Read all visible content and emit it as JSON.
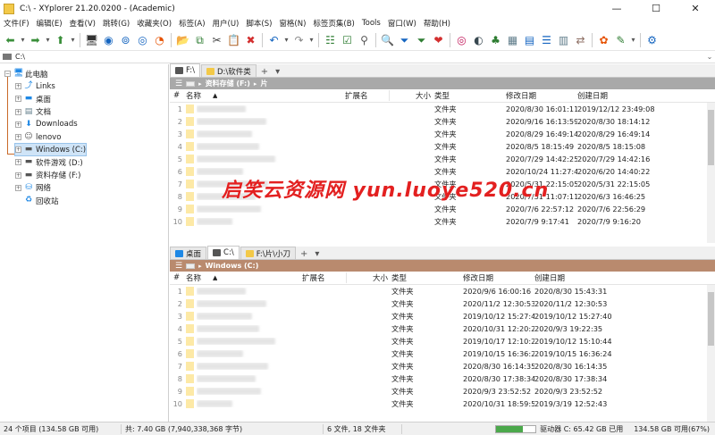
{
  "window": {
    "title": "C:\\ - XYplorer 21.20.0200 - (Academic)",
    "min": "—",
    "max": "☐",
    "close": "✕"
  },
  "menu": [
    "文件(F)",
    "编辑(E)",
    "查看(V)",
    "跳转(G)",
    "收藏夹(O)",
    "标签(A)",
    "用户(U)",
    "脚本(S)",
    "窗格(N)",
    "标签页集(B)",
    "Tools",
    "窗口(W)",
    "帮助(H)"
  ],
  "toolbar": [
    {
      "name": "back-icon",
      "glyph": "⬅",
      "color": "#3a8f3a"
    },
    {
      "name": "back-dropdown-icon",
      "glyph": "▾",
      "color": "#555"
    },
    {
      "name": "forward-icon",
      "glyph": "➡",
      "color": "#3a8f3a"
    },
    {
      "name": "forward-dropdown-icon",
      "glyph": "▾",
      "color": "#555"
    },
    {
      "name": "up-icon",
      "glyph": "⬆",
      "color": "#3a8f3a"
    },
    {
      "name": "up-dropdown-icon",
      "glyph": "▾",
      "color": "#555"
    },
    {
      "name": "sep"
    },
    {
      "name": "computer-icon",
      "glyph": "🖥",
      "color": "#333"
    },
    {
      "name": "target-icon",
      "glyph": "◉",
      "color": "#1565c0"
    },
    {
      "name": "find-icon",
      "glyph": "⊚",
      "color": "#1565c0"
    },
    {
      "name": "history-icon",
      "glyph": "◎",
      "color": "#1565c0"
    },
    {
      "name": "recent-icon",
      "glyph": "◔",
      "color": "#e65100"
    },
    {
      "name": "sep"
    },
    {
      "name": "new-folder-icon",
      "glyph": "📂",
      "color": "#d9a520"
    },
    {
      "name": "copy-icon",
      "glyph": "⧉",
      "color": "#2e7d32"
    },
    {
      "name": "cut-icon",
      "glyph": "✂",
      "color": "#444"
    },
    {
      "name": "paste-icon",
      "glyph": "📋",
      "color": "#555"
    },
    {
      "name": "delete-icon",
      "glyph": "✖",
      "color": "#d32f2f"
    },
    {
      "name": "sep"
    },
    {
      "name": "undo-icon",
      "glyph": "↶",
      "color": "#1565c0"
    },
    {
      "name": "undo-dropdown-icon",
      "glyph": "▾",
      "color": "#555"
    },
    {
      "name": "redo-icon",
      "glyph": "↷",
      "color": "#888"
    },
    {
      "name": "redo-dropdown-icon",
      "glyph": "▾",
      "color": "#555"
    },
    {
      "name": "sep"
    },
    {
      "name": "tree-view-icon",
      "glyph": "☷",
      "color": "#2e7d32"
    },
    {
      "name": "checkbox-icon",
      "glyph": "☑",
      "color": "#2e7d32"
    },
    {
      "name": "pin-icon",
      "glyph": "⚲",
      "color": "#555"
    },
    {
      "name": "sep"
    },
    {
      "name": "search-icon",
      "glyph": "🔍",
      "color": "#1565c0"
    },
    {
      "name": "filter-icon",
      "glyph": "⏷",
      "color": "#1565c0"
    },
    {
      "name": "visual-filter-icon",
      "glyph": "⏷",
      "color": "#2e7d32"
    },
    {
      "name": "tag-icon",
      "glyph": "❤",
      "color": "#d32f2f"
    },
    {
      "name": "sep"
    },
    {
      "name": "spiral-icon",
      "glyph": "◎",
      "color": "#c2185b"
    },
    {
      "name": "moon-icon",
      "glyph": "◐",
      "color": "#37474f"
    },
    {
      "name": "tree-icon",
      "glyph": "♣",
      "color": "#2e7d32"
    },
    {
      "name": "grid-icon",
      "glyph": "▦",
      "color": "#607d8b"
    },
    {
      "name": "details-view-icon",
      "glyph": "▤",
      "color": "#1565c0"
    },
    {
      "name": "list-view-icon",
      "glyph": "☰",
      "color": "#1565c0"
    },
    {
      "name": "preview-icon",
      "glyph": "▥",
      "color": "#607d8b"
    },
    {
      "name": "sync-icon",
      "glyph": "⇄",
      "color": "#8d6e63"
    },
    {
      "name": "sep"
    },
    {
      "name": "color-filter-icon",
      "glyph": "✿",
      "color": "#e65100"
    },
    {
      "name": "brush-icon",
      "glyph": "✎",
      "color": "#2e7d32"
    },
    {
      "name": "brush-dropdown-icon",
      "glyph": "▾",
      "color": "#555"
    },
    {
      "name": "sep"
    },
    {
      "name": "settings-icon",
      "glyph": "⚙",
      "color": "#1565c0"
    }
  ],
  "address": "C:\\",
  "tree": {
    "items": [
      {
        "label": "此电脑",
        "icon": "computer-icon",
        "glyph": "🖥",
        "color": "#1e88e5",
        "level": 0,
        "exp": "−"
      },
      {
        "label": "Links",
        "icon": "link-icon",
        "glyph": "⤴",
        "color": "#1e88e5",
        "level": 1,
        "exp": "+"
      },
      {
        "label": "桌面",
        "icon": "desktop-icon",
        "glyph": "▬",
        "color": "#1e88e5",
        "level": 1,
        "exp": "+"
      },
      {
        "label": "文档",
        "icon": "document-icon",
        "glyph": "▤",
        "color": "#607d8b",
        "level": 1,
        "exp": "+"
      },
      {
        "label": "Downloads",
        "icon": "download-icon",
        "glyph": "⬇",
        "color": "#1e88e5",
        "level": 1,
        "exp": "+"
      },
      {
        "label": "lenovo",
        "icon": "user-icon",
        "glyph": "☺",
        "color": "#555",
        "level": 1,
        "exp": "+"
      },
      {
        "label": "Windows (C:)",
        "icon": "drive-icon",
        "glyph": "▬",
        "color": "#555",
        "level": 1,
        "exp": "+",
        "selected": true
      },
      {
        "label": "软件游戏 (D:)",
        "icon": "drive-icon",
        "glyph": "▬",
        "color": "#555",
        "level": 1,
        "exp": "+"
      },
      {
        "label": "资料存储 (F:)",
        "icon": "drive-icon",
        "glyph": "▬",
        "color": "#555",
        "level": 1,
        "exp": "+"
      },
      {
        "label": "网络",
        "icon": "network-icon",
        "glyph": "⛁",
        "color": "#1e88e5",
        "level": 1,
        "exp": "+"
      },
      {
        "label": "回收站",
        "icon": "recycle-bin-icon",
        "glyph": "♻",
        "color": "#1e88e5",
        "level": 1,
        "exp": ""
      }
    ]
  },
  "pane1": {
    "tabs": [
      {
        "label": "F:\\",
        "icon_color": "#555",
        "active": true
      },
      {
        "label": "D:\\软件类",
        "icon_color": "#f3c948",
        "active": false
      }
    ],
    "add": "+",
    "more": "▾",
    "path": [
      "资料存储 (F:)",
      "片"
    ],
    "path_color": "#a9a9a9",
    "columns": [
      "#",
      "名称",
      "▲",
      "扩展名",
      "大小",
      "类型",
      "修改日期",
      "创建日期"
    ],
    "rows": [
      {
        "n": "1",
        "type": "文件夹",
        "mod": "2020/8/30 16:01:11",
        "cre": "2019/12/12 23:49:08"
      },
      {
        "n": "2",
        "type": "文件夹",
        "mod": "2020/9/16 16:13:59",
        "cre": "2020/8/30 18:14:12"
      },
      {
        "n": "3",
        "type": "文件夹",
        "mod": "2020/8/29 16:49:14",
        "cre": "2020/8/29 16:49:14"
      },
      {
        "n": "4",
        "type": "文件夹",
        "mod": "2020/8/5 18:15:49",
        "cre": "2020/8/5 18:15:08"
      },
      {
        "n": "5",
        "type": "文件夹",
        "mod": "2020/7/29 14:42:25",
        "cre": "2020/7/29 14:42:16"
      },
      {
        "n": "6",
        "type": "文件夹",
        "mod": "2020/10/24 11:27:47",
        "cre": "2020/6/20 14:40:22"
      },
      {
        "n": "7",
        "type": "文件夹",
        "mod": "2020/5/31 22:15:05",
        "cre": "2020/5/31 22:15:05"
      },
      {
        "n": "8",
        "type": "文件夹",
        "mod": "2020/7/31 11:07:11",
        "cre": "2020/6/3 16:46:25"
      },
      {
        "n": "9",
        "type": "文件夹",
        "mod": "2020/7/6 22:57:12",
        "cre": "2020/7/6 22:56:29"
      },
      {
        "n": "10",
        "type": "文件夹",
        "mod": "2020/7/9 9:17:41",
        "cre": "2020/7/9 9:16:20"
      }
    ]
  },
  "pane2": {
    "tabs": [
      {
        "label": "桌面",
        "icon_color": "#1e88e5",
        "active": false
      },
      {
        "label": "C:\\",
        "icon_color": "#555",
        "active": true
      },
      {
        "label": "F:\\片\\小刀",
        "icon_color": "#f3c948",
        "active": false
      }
    ],
    "add": "+",
    "more": "▾",
    "path": [
      "Windows (C:)"
    ],
    "path_color": "#b98a6e",
    "columns": [
      "#",
      "名称",
      "▲",
      "扩展名",
      "大小",
      "类型",
      "修改日期",
      "创建日期"
    ],
    "rows": [
      {
        "n": "1",
        "type": "文件夹",
        "mod": "2020/9/6 16:00:16",
        "cre": "2020/8/30 15:43:31"
      },
      {
        "n": "2",
        "type": "文件夹",
        "mod": "2020/11/2 12:30:53",
        "cre": "2020/11/2 12:30:53"
      },
      {
        "n": "3",
        "type": "文件夹",
        "mod": "2019/10/12 15:27:40",
        "cre": "2019/10/12 15:27:40"
      },
      {
        "n": "4",
        "type": "文件夹",
        "mod": "2020/10/31 12:20:25",
        "cre": "2020/9/3 19:22:35"
      },
      {
        "n": "5",
        "type": "文件夹",
        "mod": "2019/10/17 12:10:29",
        "cre": "2019/10/12 15:10:44"
      },
      {
        "n": "6",
        "type": "文件夹",
        "mod": "2019/10/15 16:36:24",
        "cre": "2019/10/15 16:36:24"
      },
      {
        "n": "7",
        "type": "文件夹",
        "mod": "2020/8/30 16:14:35",
        "cre": "2020/8/30 16:14:35"
      },
      {
        "n": "8",
        "type": "文件夹",
        "mod": "2020/8/30 17:38:34",
        "cre": "2020/8/30 17:38:34"
      },
      {
        "n": "9",
        "type": "文件夹",
        "mod": "2020/9/3 23:52:52",
        "cre": "2020/9/3 23:52:52"
      },
      {
        "n": "10",
        "type": "文件夹",
        "mod": "2020/10/31 18:59:50",
        "cre": "2019/3/19 12:52:43"
      }
    ]
  },
  "status": {
    "items": "24 个项目 (134.58 GB 可用)",
    "total": "共: 7.40 GB (7,940,338,368 字节)",
    "counts": "6 文件, 18 文件夹",
    "drive": "驱动器 C: 65.42 GB 已用",
    "free": "134.58 GB 可用(67%)",
    "free_fraction": 0.67
  },
  "watermark": "启笑云资源网  yun.luoye520.cn"
}
